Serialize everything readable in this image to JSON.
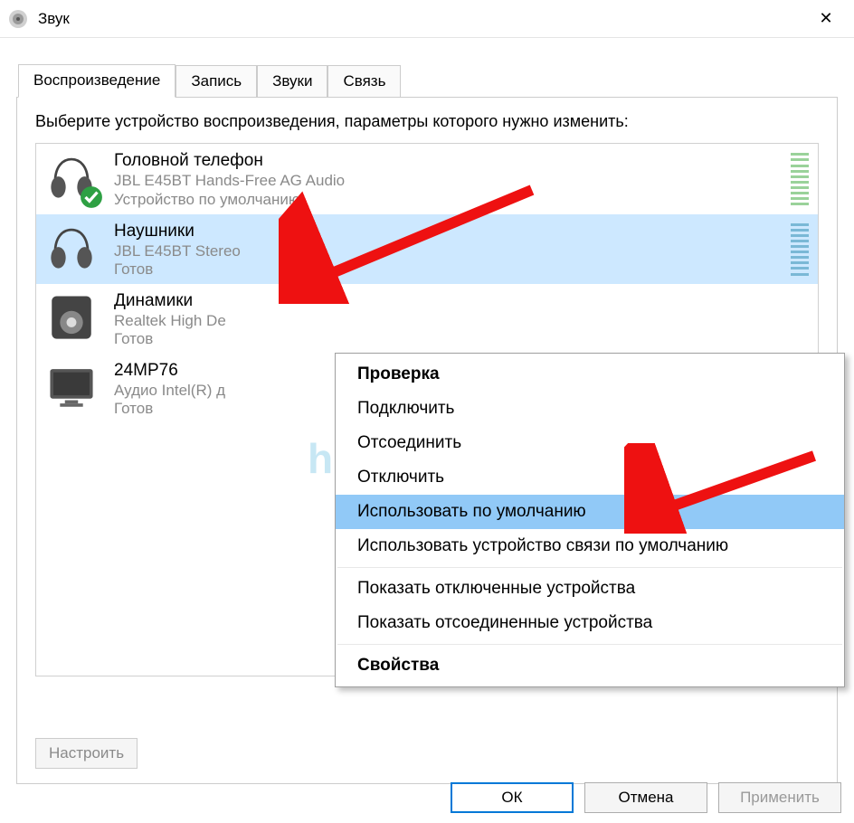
{
  "window": {
    "title": "Звук",
    "close_icon": "✕"
  },
  "tabs": [
    {
      "label": "Воспроизведение",
      "active": true
    },
    {
      "label": "Запись",
      "active": false
    },
    {
      "label": "Звуки",
      "active": false
    },
    {
      "label": "Связь",
      "active": false
    }
  ],
  "instruction": "Выберите устройство воспроизведения, параметры которого нужно изменить:",
  "devices": [
    {
      "name": "Головной телефон",
      "desc": "JBL E45BT Hands-Free AG Audio",
      "status": "Устройство по умолчанию",
      "default_check": true,
      "kind": "headphones",
      "selected": false
    },
    {
      "name": "Наушники",
      "desc": "JBL E45BT Stereo",
      "status": "Готов",
      "default_check": false,
      "kind": "headphones",
      "selected": true
    },
    {
      "name": "Динамики",
      "desc": "Realtek High De",
      "status": "Готов",
      "default_check": false,
      "kind": "speaker",
      "selected": false
    },
    {
      "name": "24MP76",
      "desc": "Аудио Intel(R) д",
      "status": "Готов",
      "default_check": false,
      "kind": "monitor",
      "selected": false
    }
  ],
  "configure_btn": "Настроить",
  "context_menu": [
    {
      "label": "Проверка",
      "bold": true
    },
    {
      "label": "Подключить"
    },
    {
      "label": "Отсоединить"
    },
    {
      "label": "Отключить"
    },
    {
      "label": "Использовать по умолчанию",
      "highlighted": true
    },
    {
      "label": "Использовать устройство связи по умолчанию"
    },
    {
      "sep": true
    },
    {
      "label": "Показать отключенные устройства"
    },
    {
      "label": "Показать отсоединенные устройства"
    },
    {
      "sep": true
    },
    {
      "label": "Свойства",
      "bold": true
    }
  ],
  "buttons": {
    "ok": "ОК",
    "cancel": "Отмена",
    "apply": "Применить"
  },
  "watermark": "help-wifi.com"
}
